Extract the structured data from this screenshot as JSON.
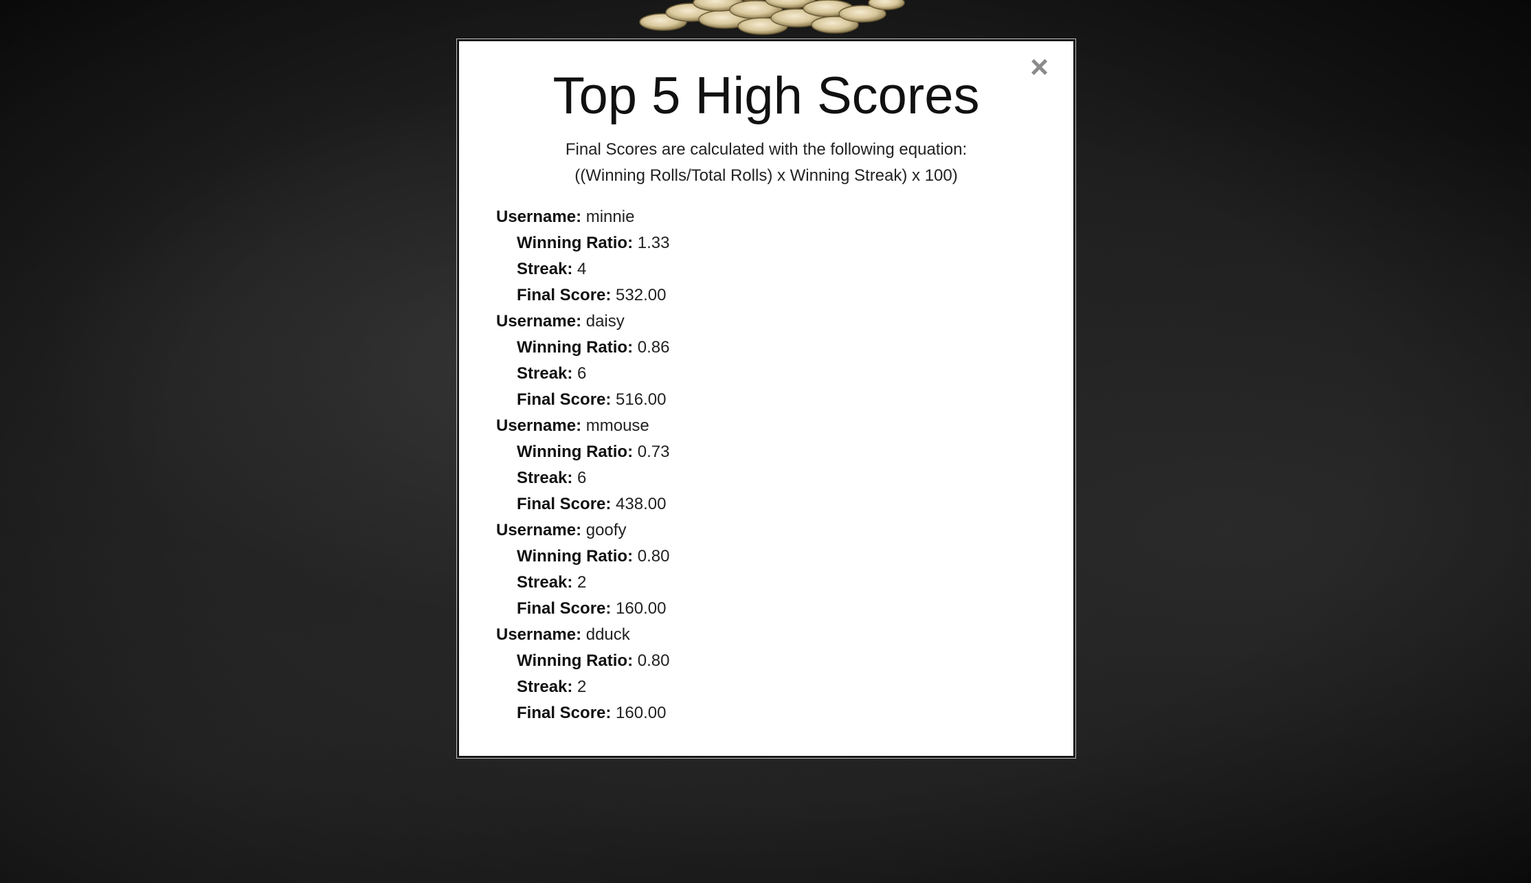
{
  "modal": {
    "close_label": "×",
    "title": "Top 5 High Scores",
    "formula_line1": "Final Scores are calculated with the following equation:",
    "formula_line2": "((Winning Rolls/Total Rolls) x Winning Streak) x 100)"
  },
  "labels": {
    "username": "Username:",
    "winning_ratio": "Winning Ratio:",
    "streak": "Streak:",
    "final_score": "Final Score:"
  },
  "scores": [
    {
      "username": "minnie",
      "winning_ratio": "1.33",
      "streak": "4",
      "final_score": "532.00"
    },
    {
      "username": "daisy",
      "winning_ratio": "0.86",
      "streak": "6",
      "final_score": "516.00"
    },
    {
      "username": "mmouse",
      "winning_ratio": "0.73",
      "streak": "6",
      "final_score": "438.00"
    },
    {
      "username": "goofy",
      "winning_ratio": "0.80",
      "streak": "2",
      "final_score": "160.00"
    },
    {
      "username": "dduck",
      "winning_ratio": "0.80",
      "streak": "2",
      "final_score": "160.00"
    }
  ],
  "colors": {
    "background": "#1b1b1b",
    "modal_background": "#ffffff",
    "close_icon": "#8a8a8a",
    "coin_gold": "#d8c79a"
  },
  "icons": {
    "close": "close-icon",
    "decoration": "coin-pile-icon"
  }
}
